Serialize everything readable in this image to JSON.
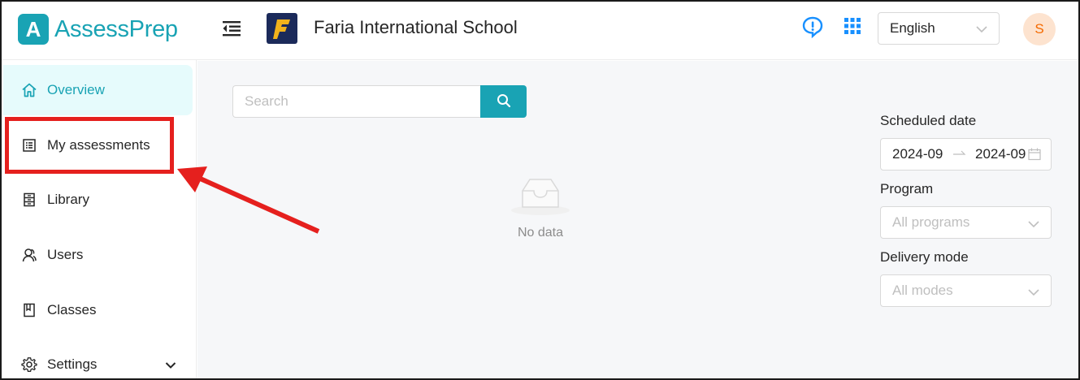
{
  "brand": {
    "logo_letter": "A",
    "name": "AssessPrep",
    "accent": "#19a3b4"
  },
  "header": {
    "school_logo_letter": "F",
    "school_name": "Faria International School",
    "language": "English",
    "avatar_initial": "S"
  },
  "sidebar": {
    "items": [
      {
        "label": "Overview",
        "icon": "home-icon",
        "active": true
      },
      {
        "label": "My assessments",
        "icon": "assessment-list-icon",
        "active": false
      },
      {
        "label": "Library",
        "icon": "library-icon",
        "active": false
      },
      {
        "label": "Users",
        "icon": "users-icon",
        "active": false
      },
      {
        "label": "Classes",
        "icon": "book-icon",
        "active": false
      },
      {
        "label": "Settings",
        "icon": "gear-icon",
        "active": false,
        "has_submenu": true
      }
    ]
  },
  "main": {
    "search": {
      "placeholder": "Search",
      "value": ""
    },
    "empty_text": "No data",
    "filters": {
      "scheduled_date_label": "Scheduled date",
      "date_start": "2024-09",
      "date_end": "2024-09",
      "program_label": "Program",
      "program_placeholder": "All programs",
      "delivery_label": "Delivery mode",
      "delivery_placeholder": "All modes"
    }
  },
  "annotation": {
    "highlight_color": "#e5201e"
  }
}
